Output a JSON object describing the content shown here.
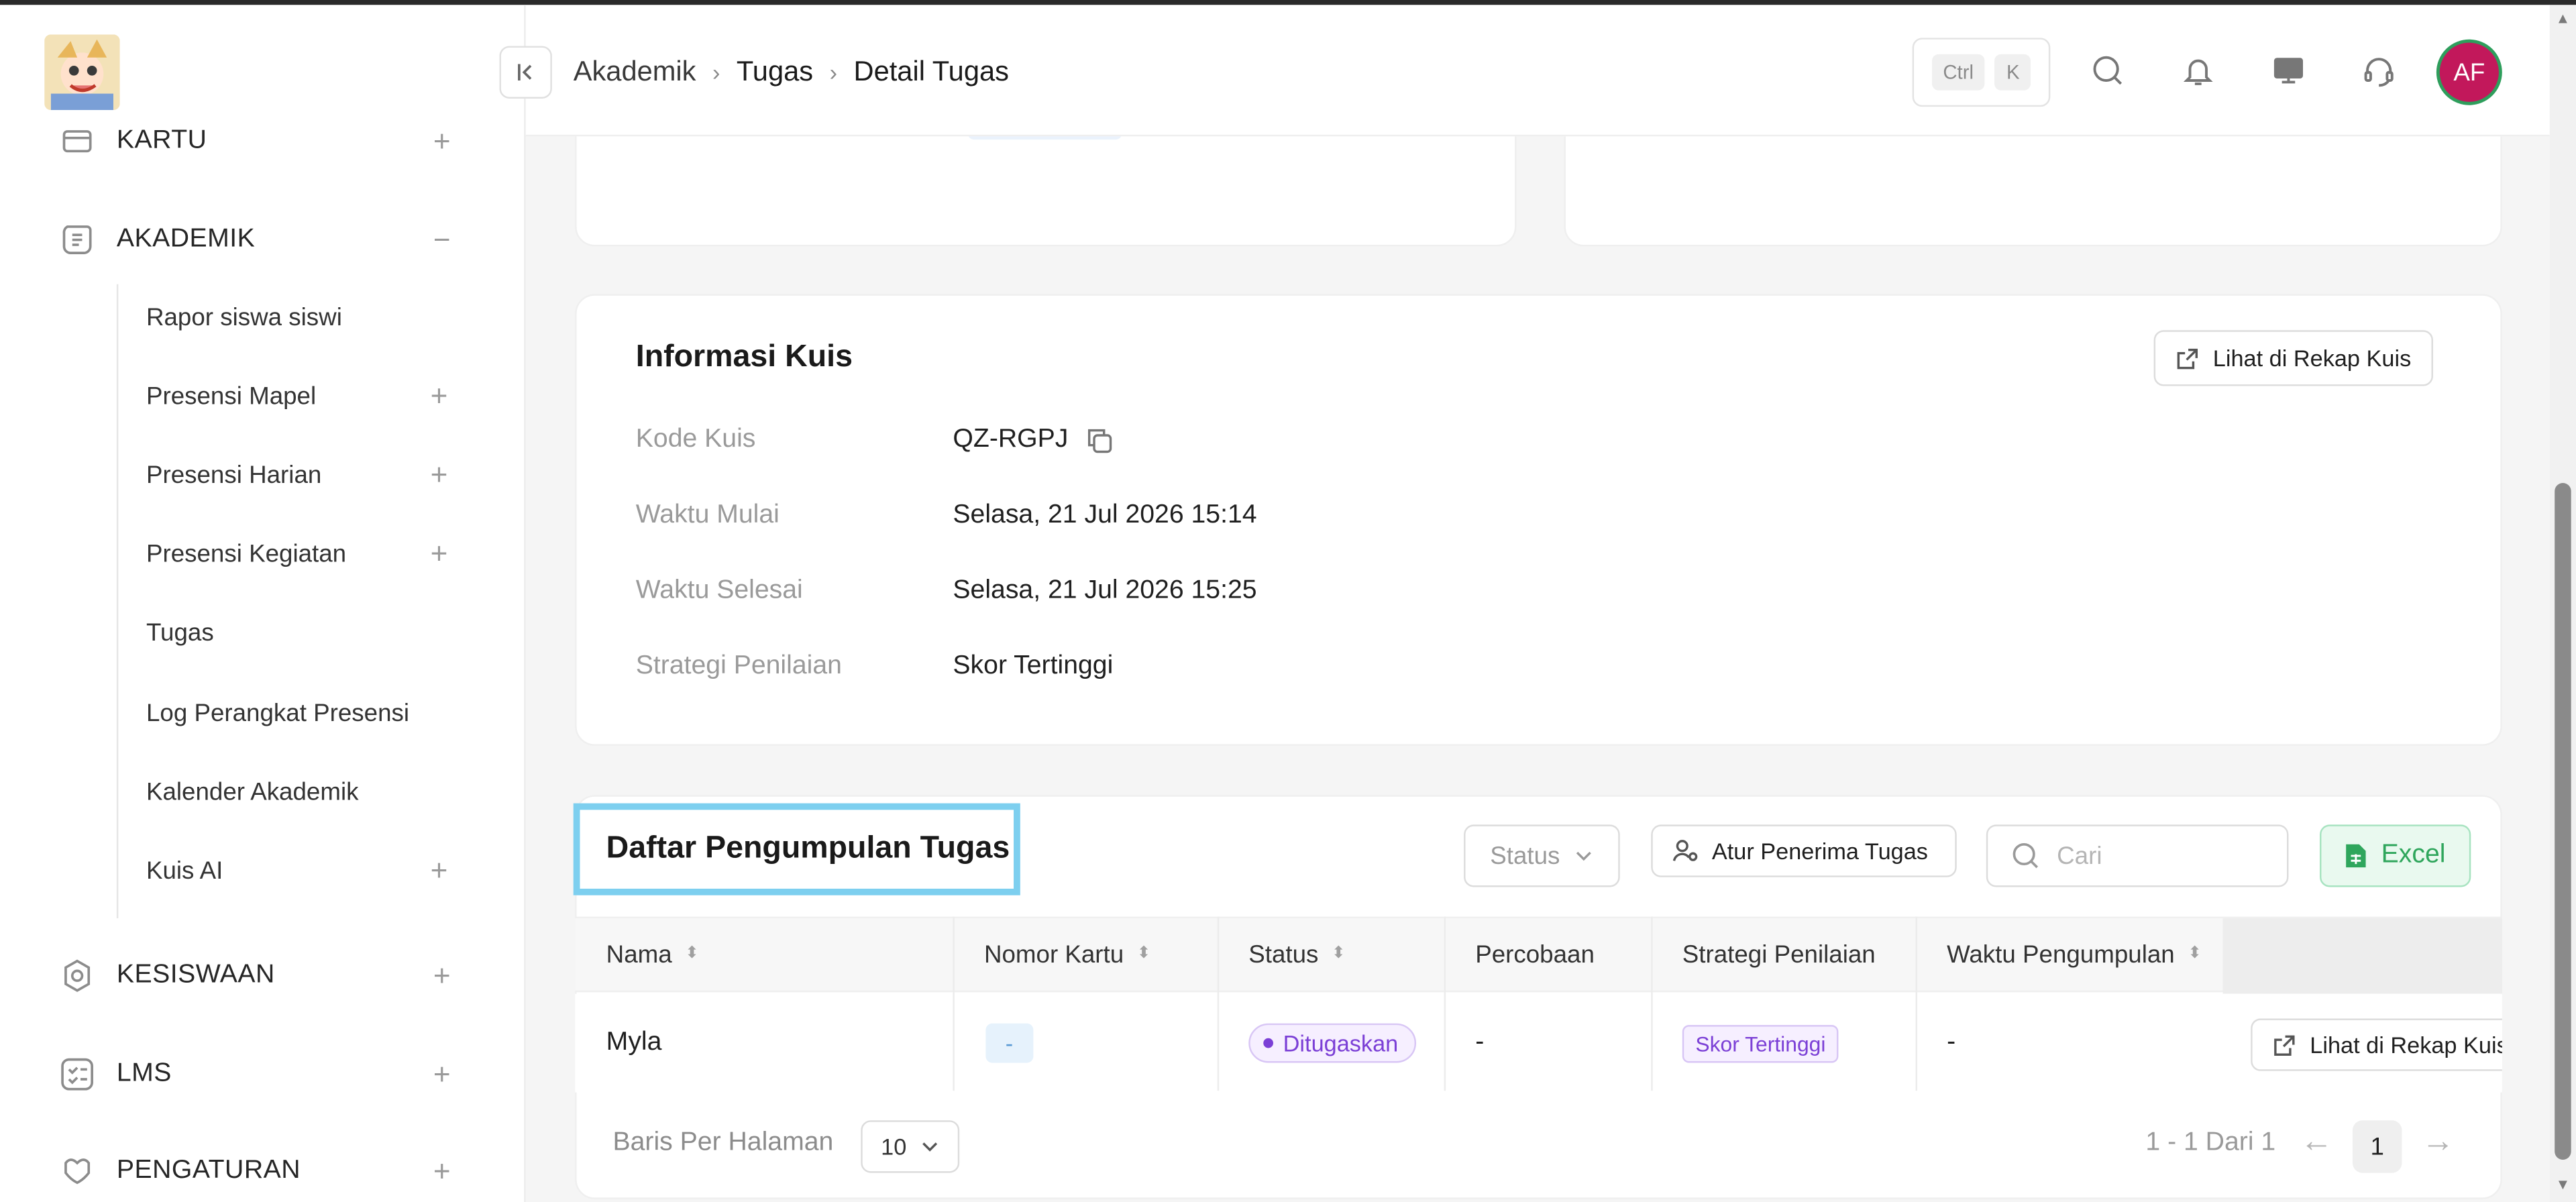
{
  "sidebar": {
    "groups": [
      {
        "label": "KARTU",
        "toggle": "+"
      },
      {
        "label": "AKADEMIK",
        "toggle": "−"
      },
      {
        "label": "KESISWAAN",
        "toggle": "+"
      },
      {
        "label": "LMS",
        "toggle": "+"
      },
      {
        "label": "PENGATURAN",
        "toggle": "+"
      }
    ],
    "akademik_items": [
      {
        "label": "Rapor siswa siswi",
        "expandable": false
      },
      {
        "label": "Presensi Mapel",
        "expandable": true
      },
      {
        "label": "Presensi Harian",
        "expandable": true
      },
      {
        "label": "Presensi Kegiatan",
        "expandable": true
      },
      {
        "label": "Tugas",
        "expandable": false
      },
      {
        "label": "Log Perangkat Presensi",
        "expandable": false
      },
      {
        "label": "Kalender Akademik",
        "expandable": false
      },
      {
        "label": "Kuis AI",
        "expandable": true
      }
    ],
    "plus_symbol": "+"
  },
  "header": {
    "breadcrumb": [
      "Akademik",
      "Tugas",
      "Detail Tugas"
    ],
    "shortcut_keys": [
      "Ctrl",
      "K"
    ],
    "avatar_initials": "AF",
    "avatar_color": "#c2185b"
  },
  "quiz_info": {
    "title": "Informasi Kuis",
    "view_recap_label": "Lihat di Rekap Kuis",
    "fields": [
      {
        "label": "Kode Kuis",
        "value": "QZ-RGPJ"
      },
      {
        "label": "Waktu Mulai",
        "value": "Selasa, 21 Jul 2026 15:14"
      },
      {
        "label": "Waktu Selesai",
        "value": "Selasa, 21 Jul 2026 15:25"
      },
      {
        "label": "Strategi Penilaian",
        "value": "Skor Tertinggi"
      }
    ]
  },
  "submissions": {
    "title": "Daftar Pengumpulan Tugas",
    "status_filter": "Status",
    "assign_label": "Atur Penerima Tugas",
    "search_placeholder": "Cari",
    "excel_label": "Excel",
    "columns": [
      "Nama",
      "Nomor Kartu",
      "Status",
      "Percobaan",
      "Strategi Penilaian",
      "Waktu Pengumpulan"
    ],
    "rows": [
      {
        "nama": "Myla",
        "nomor_kartu": "-",
        "status": "Ditugaskan",
        "percobaan": "-",
        "strategi": "Skor Tertinggi",
        "waktu": "-",
        "action": "Lihat di Rekap Kuis"
      }
    ],
    "rows_per_page_label": "Baris Per Halaman",
    "rows_per_page": "10",
    "range_text": "1 - 1 Dari 1",
    "current_page": "1",
    "prev_arrow": "←",
    "next_arrow": "→"
  },
  "colors": {
    "accent_highlight": "#7dcfef",
    "excel_green": "#2fa65c",
    "status_purple": "#7b3fd6"
  }
}
